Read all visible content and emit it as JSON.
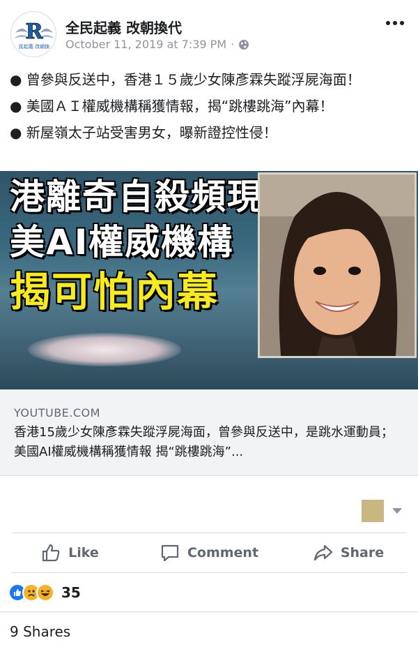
{
  "post": {
    "page_name": "全民起義 改朝換代",
    "timestamp": "October 11, 2019 at 7:39 PM",
    "separator": "·",
    "avatar_letter": "R",
    "avatar_caption": "民起義 改朝換",
    "lines": [
      "● 曾參與反送中，香港１５歲少女陳彥霖失蹤浮屍海面！",
      "● 美國ＡＩ權威機構稱獲情報，揭“跳樓跳海”內幕！",
      "● 新屋嶺太子站受害男女，曝新證控性侵！"
    ]
  },
  "thumbnail": {
    "line1": "港離奇自殺頻現",
    "line2": "美AI權威機構",
    "line3": "揭可怕內幕"
  },
  "link": {
    "domain": "YOUTUBE.COM",
    "title": "香港15歲少女陳彥霖失蹤浮屍海面，曾參與反送中，是跳水運動員；美國AI權威機構稱獲情報 揭“跳樓跳海”..."
  },
  "actions": {
    "like": "Like",
    "comment": "Comment",
    "share": "Share"
  },
  "footer": {
    "reaction_count": "35",
    "shares": "9 Shares"
  },
  "colors": {
    "like_blue": "#1877f2",
    "emoji_yellow": "#f7b125",
    "reaction_swatch": "#c9b781"
  }
}
